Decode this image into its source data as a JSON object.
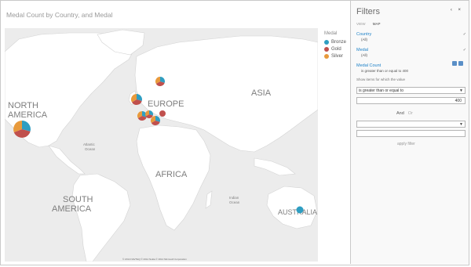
{
  "map": {
    "title": "Medal Count by Country, and Medal",
    "labels": {
      "north_america": [
        "NORTH",
        "AMERICA"
      ],
      "europe": "EUROPE",
      "asia": "ASIA",
      "africa": "AFRICA",
      "south_america": [
        "SOUTH",
        "AMERICA"
      ],
      "australia": "AUSTRALIA",
      "atlantic": [
        "Atlantic",
        "Ocean"
      ],
      "indian": [
        "Indian",
        "Ocean"
      ]
    },
    "credit": "© 2014 NAVTEQ  © 2014 Nokia  © 2014 Microsoft Corporation",
    "legend": {
      "title": "Medal",
      "items": [
        {
          "label": "Bronze",
          "color": "#2e9ec2"
        },
        {
          "label": "Gold",
          "color": "#c0504d"
        },
        {
          "label": "Silver",
          "color": "#e89a3c"
        }
      ]
    }
  },
  "filters": {
    "title": "Filters",
    "controls": "‹ ×",
    "tabs": [
      "VIEW",
      "MAP"
    ],
    "items": [
      {
        "name": "Country",
        "value": "(All)"
      },
      {
        "name": "Medal",
        "value": "(All)"
      },
      {
        "name": "Medal Count",
        "value": "is greater than or equal to 400"
      }
    ],
    "hint": "Show items for which the value",
    "condition1": "is greater than or equal to",
    "value1": "400",
    "and_label": "And",
    "or_label": "Or",
    "condition2": "",
    "value2": "",
    "apply_label": "apply filter"
  }
}
